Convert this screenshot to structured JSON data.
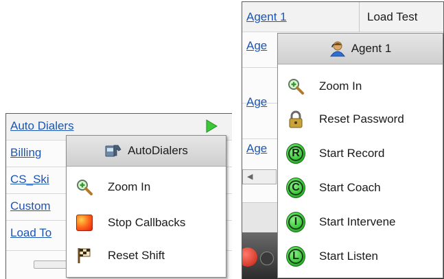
{
  "left_table": {
    "rows": [
      "Auto Dialers",
      "Billing",
      "CS_Ski",
      "Custom",
      "Load To"
    ]
  },
  "left_menu": {
    "header": "AutoDialers",
    "items": [
      {
        "label": "Zoom In",
        "icon": "zoom-in-icon"
      },
      {
        "label": "Stop Callbacks",
        "icon": "stop-icon"
      },
      {
        "label": "Reset Shift",
        "icon": "flag-icon"
      }
    ]
  },
  "right_table": {
    "rows": [
      "Agent 1",
      "Age",
      "Age",
      "Age"
    ],
    "header_col2": "Load Test"
  },
  "right_menu": {
    "header": "Agent 1",
    "items": [
      {
        "label": "Zoom In",
        "icon": "zoom-in-icon"
      },
      {
        "label": "Reset Password",
        "icon": "lock-icon"
      },
      {
        "label": "Start Record",
        "icon": "record-icon",
        "letter": "R"
      },
      {
        "label": "Start Coach",
        "icon": "coach-icon",
        "letter": "C"
      },
      {
        "label": "Start Intervene",
        "icon": "intervene-icon",
        "letter": "I"
      },
      {
        "label": "Start Listen",
        "icon": "listen-icon",
        "letter": "L"
      }
    ]
  },
  "colors": {
    "link": "#1b55b3",
    "menu_header": "#d6d6d6",
    "status_green": "#3cc63a"
  }
}
